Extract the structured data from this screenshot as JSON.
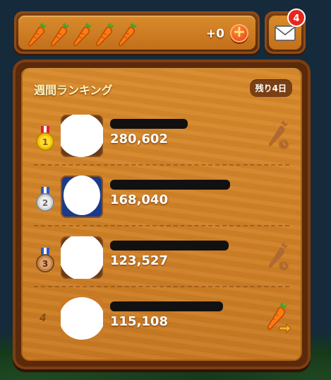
{
  "topbar": {
    "carrot_count": 5,
    "bonus_text": "+0",
    "add_label": "+"
  },
  "mail": {
    "badge_count": "4"
  },
  "ranking": {
    "title": "週間ランキング",
    "days_left": "残り4日",
    "rows": [
      {
        "rank": "1",
        "score": "280,602",
        "action": "carrot-sent-icon"
      },
      {
        "rank": "2",
        "score": "168,040",
        "action": ""
      },
      {
        "rank": "3",
        "score": "123,527",
        "action": "carrot-sent-icon"
      },
      {
        "rank": "4",
        "score": "115,108",
        "action": "send-carrot-icon"
      }
    ]
  },
  "colors": {
    "wood_light": "#d98a2c",
    "wood_dark": "#5a2a0a",
    "text_title": "#fff6c0",
    "badge_red": "#e8261a"
  }
}
